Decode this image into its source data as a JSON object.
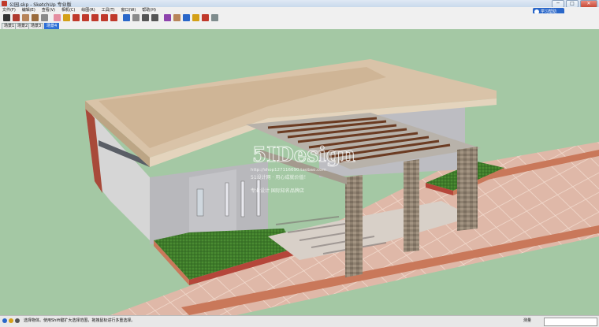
{
  "window": {
    "title": "公园.skp - SketchUp 专业版",
    "minimize_glyph": "─",
    "maximize_glyph": "□",
    "close_glyph": "✕"
  },
  "menubar": {
    "items": [
      {
        "label": "文件(F)"
      },
      {
        "label": "编辑(E)"
      },
      {
        "label": "查看(V)"
      },
      {
        "label": "相机(C)"
      },
      {
        "label": "绘图(R)"
      },
      {
        "label": "工具(T)"
      },
      {
        "label": "窗口(W)"
      },
      {
        "label": "帮助(H)"
      }
    ]
  },
  "help_badge": {
    "label": "学习帮助"
  },
  "toolbar": {
    "tools": [
      {
        "icon": "select-arrow-icon",
        "color": "#333333"
      },
      {
        "icon": "pencil-line-icon",
        "color": "#b03a2e"
      },
      {
        "icon": "rectangle-icon",
        "color": "#b8855a"
      },
      {
        "icon": "circle-icon",
        "color": "#9a6b3c"
      },
      {
        "icon": "polygon-icon",
        "color": "#8a8a8a"
      },
      {
        "icon": "eraser-icon",
        "color": "#e58ea0"
      },
      {
        "icon": "paint-bucket-icon",
        "color": "#d4a017"
      },
      {
        "icon": "push-pull-icon",
        "color": "#c0392b"
      },
      {
        "icon": "move-icon",
        "color": "#c0392b"
      },
      {
        "icon": "rotate-icon",
        "color": "#c0392b"
      },
      {
        "icon": "follow-me-icon",
        "color": "#c0392b"
      },
      {
        "icon": "offset-icon",
        "color": "#c0392b"
      },
      {
        "icon": "orbit-icon",
        "color": "#2a67c9"
      },
      {
        "icon": "pan-hand-icon",
        "color": "#8a8a8a"
      },
      {
        "icon": "zoom-icon",
        "color": "#555555"
      },
      {
        "icon": "zoom-extents-icon",
        "color": "#555555"
      },
      {
        "icon": "warehouse-icon",
        "color": "#8e44ad"
      },
      {
        "icon": "components-icon",
        "color": "#b8855a"
      },
      {
        "icon": "geo-location-icon",
        "color": "#2a67c9"
      },
      {
        "icon": "extension-icon",
        "color": "#d4a017"
      },
      {
        "icon": "materials-icon",
        "color": "#c0392b"
      },
      {
        "icon": "styles-icon",
        "color": "#7f8c8d"
      }
    ]
  },
  "scene_tabs": [
    {
      "label": "场景1",
      "active": false
    },
    {
      "label": "场景2",
      "active": false
    },
    {
      "label": "场景3",
      "active": false
    },
    {
      "label": "场景4",
      "active": true
    }
  ],
  "viewport": {
    "watermark": {
      "logo_text": "5IDesign",
      "url": "http://shop127116690.taobao.com",
      "line2": "51设计网 · 用心成就价值！",
      "line3": "专业设计   国际知名品牌店"
    }
  },
  "statusbar": {
    "hint": "选择物体。使用Shift键扩大选择范围，拖拽鼠标进行多重选择。",
    "measure_label": "测量"
  }
}
